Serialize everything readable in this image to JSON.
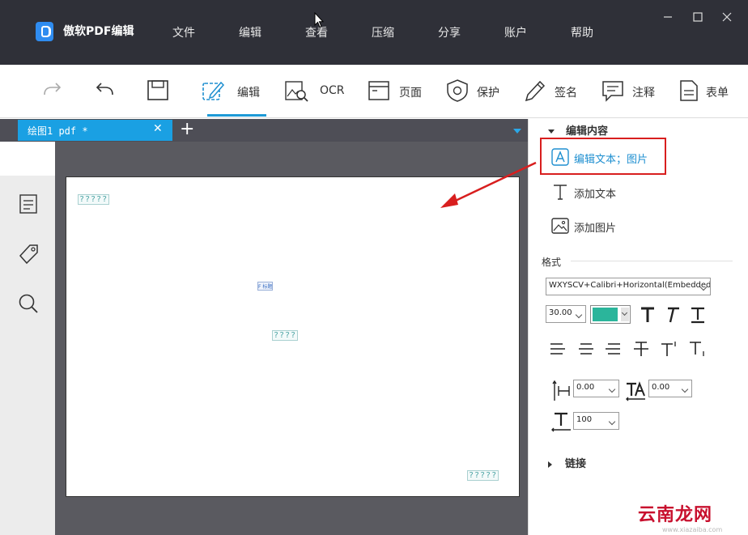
{
  "app": {
    "title": "傲软PDF编辑",
    "menu": [
      "文件",
      "编辑",
      "查看",
      "压缩",
      "分享",
      "账户",
      "帮助"
    ]
  },
  "window_controls": [
    "minimize",
    "maximize",
    "close"
  ],
  "toolbar": {
    "redo_icon": "redo-icon",
    "undo_icon": "undo-icon",
    "save_icon": "save-icon",
    "items": [
      {
        "label": "编辑",
        "icon": "edit-icon",
        "active": true
      },
      {
        "label": "OCR",
        "icon": "ocr-icon"
      },
      {
        "label": "页面",
        "icon": "page-icon"
      },
      {
        "label": "保护",
        "icon": "shield-icon"
      },
      {
        "label": "签名",
        "icon": "pen-icon"
      },
      {
        "label": "注释",
        "icon": "comment-icon"
      },
      {
        "label": "表单",
        "icon": "form-icon"
      }
    ]
  },
  "tabs": {
    "documents": [
      {
        "label": "绘图1 pdf *",
        "active": true
      }
    ],
    "add_icon": "plus-icon"
  },
  "left_sidebar": [
    "thumbnails-icon",
    "bookmark-tag-icon",
    "search-icon"
  ],
  "page_content": {
    "text_boxes": [
      {
        "text": "?????"
      },
      {
        "text": "????"
      },
      {
        "text": "?????"
      }
    ],
    "small_label": "F 标题"
  },
  "right_panel": {
    "edit_section": {
      "title": "编辑内容",
      "options": [
        {
          "label": "编辑文本；图片",
          "icon": "edit-text-image-icon",
          "selected": true
        },
        {
          "label": "添加文本",
          "icon": "text-t-icon"
        },
        {
          "label": "添加图片",
          "icon": "image-icon"
        }
      ]
    },
    "format": {
      "label": "格式",
      "font": "WXYSCV+Calibri+Horizontal(Embedded)",
      "font_size": "30.00",
      "color": "#2bb59b",
      "char_spacing": "0.00",
      "word_spacing": "0.00",
      "scale": "100"
    },
    "link_section": {
      "title": "链接"
    }
  },
  "watermark": {
    "text": "云南龙网",
    "sub": "www.xiazaiba.com"
  }
}
